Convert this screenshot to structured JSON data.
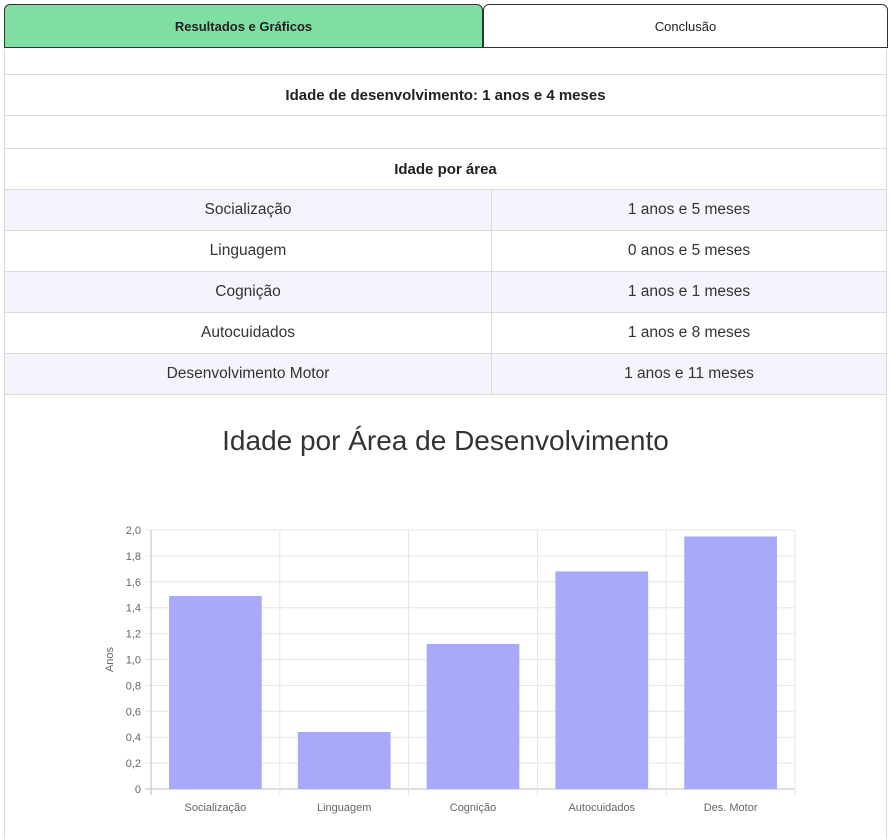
{
  "tabs": {
    "results": "Resultados e Gráficos",
    "conclusion": "Conclusão"
  },
  "development_age": "Idade de desenvolvimento: 1 anos e 4 meses",
  "area_table": {
    "header": "Idade por área",
    "rows": [
      {
        "area": "Socialização",
        "age": "1 anos e 5 meses"
      },
      {
        "area": "Linguagem",
        "age": "0 anos e 5 meses"
      },
      {
        "area": "Cognição",
        "age": "1 anos e 1 meses"
      },
      {
        "area": "Autocuidados",
        "age": "1 anos e 8 meses"
      },
      {
        "area": "Desenvolvimento Motor",
        "age": "1 anos e 11 meses"
      }
    ]
  },
  "colors": {
    "active_tab": "#80dea2",
    "bar_fill": "#a9a9fc",
    "row_alt": "#f4f5fc"
  },
  "chart_data": {
    "type": "bar",
    "title": "Idade por Área de Desenvolvimento",
    "ylabel": "Anos",
    "xlabel": "",
    "categories": [
      "Socialização",
      "Linguagem",
      "Cognição",
      "Autocuidados",
      "Des. Motor"
    ],
    "values": [
      1.49,
      0.44,
      1.12,
      1.68,
      1.95
    ],
    "ylim": [
      0,
      2
    ],
    "yticks": [
      "0",
      "0,2",
      "0,4",
      "0,6",
      "0,8",
      "1,0",
      "1,2",
      "1,4",
      "1,6",
      "1,8",
      "2,0"
    ],
    "grid": true
  }
}
